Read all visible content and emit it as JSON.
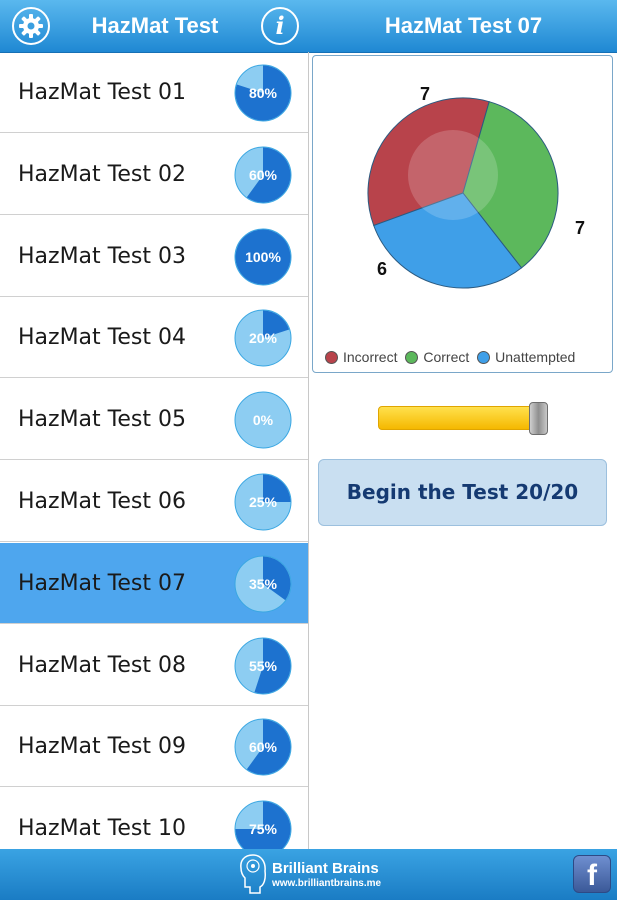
{
  "header": {
    "left_title": "HazMat Test",
    "right_title": "HazMat Test 07",
    "settings_icon": "gear-icon",
    "info_icon": "info-icon",
    "info_glyph": "i"
  },
  "tests": [
    {
      "label": "HazMat Test 01",
      "score": "80%",
      "fraction": 0.8
    },
    {
      "label": "HazMat Test 02",
      "score": "60%",
      "fraction": 0.6
    },
    {
      "label": "HazMat Test 03",
      "score": "100%",
      "fraction": 1.0
    },
    {
      "label": "HazMat Test 04",
      "score": "20%",
      "fraction": 0.2
    },
    {
      "label": "HazMat Test 05",
      "score": "0%",
      "fraction": 0.0
    },
    {
      "label": "HazMat Test 06",
      "score": "25%",
      "fraction": 0.25
    },
    {
      "label": "HazMat Test 07",
      "score": "35%",
      "fraction": 0.35,
      "selected": true
    },
    {
      "label": "HazMat Test 08",
      "score": "55%",
      "fraction": 0.55
    },
    {
      "label": "HazMat Test 09",
      "score": "60%",
      "fraction": 0.6
    },
    {
      "label": "HazMat Test 10",
      "score": "75%",
      "fraction": 0.75
    }
  ],
  "chart_data": {
    "type": "pie",
    "categories": [
      "Incorrect",
      "Correct",
      "Unattempted"
    ],
    "values": [
      7,
      7,
      6
    ],
    "colors": [
      "#b8434b",
      "#5cb85c",
      "#3f9fe8"
    ],
    "legend_position": "bottom"
  },
  "slider": {
    "value": 20,
    "max": 20
  },
  "begin_button": {
    "label": "Begin the Test 20/20"
  },
  "footer": {
    "brand_name": "Brilliant Brains",
    "brand_url": "www.brilliantbrains.me",
    "facebook_icon": "facebook-icon",
    "facebook_glyph": "f"
  }
}
